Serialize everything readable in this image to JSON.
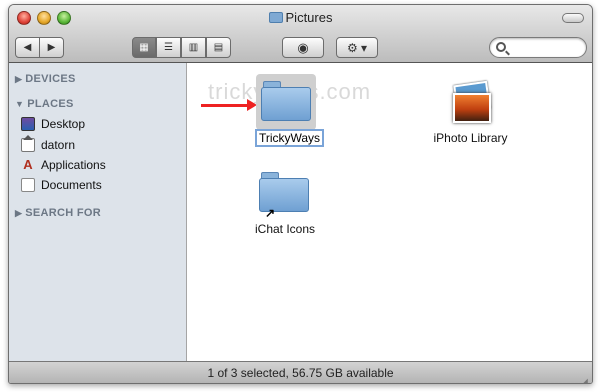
{
  "window": {
    "title": "Pictures"
  },
  "toolbar": {
    "back_icon": "◀",
    "forward_icon": "▶",
    "icon_view": "▦",
    "list_view": "☰",
    "column_view": "▥",
    "coverflow_view": "▤",
    "quicklook_icon": "◉",
    "action_icon": "⚙ ▾"
  },
  "sidebar": {
    "sections": [
      {
        "label": "DEVICES"
      },
      {
        "label": "PLACES"
      },
      {
        "label": "SEARCH FOR"
      }
    ],
    "items": [
      {
        "label": "Desktop"
      },
      {
        "label": "datorn"
      },
      {
        "label": "Applications"
      },
      {
        "label": "Documents"
      }
    ],
    "apps_glyph": "A"
  },
  "watermark": "trickyways.com",
  "files": [
    {
      "name": "TrickyWays"
    },
    {
      "name": "iPhoto Library"
    },
    {
      "name": "iChat Icons"
    }
  ],
  "alias_arrow": "↗",
  "status": {
    "text": "1 of 3 selected, 56.75 GB available"
  }
}
